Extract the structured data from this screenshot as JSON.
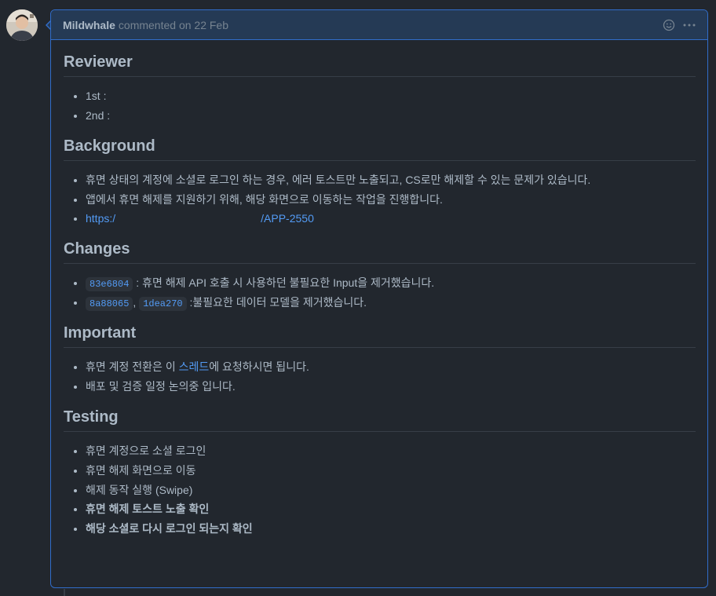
{
  "comment": {
    "author": "Mildwhale",
    "meta": "commented on 22 Feb"
  },
  "sections": {
    "reviewer": {
      "heading": "Reviewer",
      "items": [
        "1st :",
        "2nd :"
      ]
    },
    "background": {
      "heading": "Background",
      "items": [
        "휴면 상태의 계정에 소셜로 로그인 하는 경우, 에러 토스트만 노출되고, CS로만 해제할 수 있는 문제가 있습니다.",
        "앱에서 휴면 해제를 지원하기 위해, 해당 화면으로 이동하는 작업을 진행합니다."
      ],
      "link_prefix": "https:/",
      "link_suffix": "/APP-2550"
    },
    "changes": {
      "heading": "Changes",
      "items": [
        {
          "shas": [
            "83e6804"
          ],
          "text": " : 휴면 해제 API 호출 시 사용하던 불필요한 Input을 제거했습니다."
        },
        {
          "shas": [
            "8a88065",
            "1dea270"
          ],
          "separator": ", ",
          "text": " :불필요한 데이터 모델을 제거했습니다."
        }
      ]
    },
    "important": {
      "heading": "Important",
      "item1_before": "휴면 계정 전환은 이 ",
      "item1_link": "스레드",
      "item1_after": "에 요청하시면 됩니다.",
      "item2": "배포 및 검증 일정 논의중 입니다."
    },
    "testing": {
      "heading": "Testing",
      "items": [
        "휴면 계정으로 소셜 로그인",
        "휴면 해제 화면으로 이동",
        "해제 동작 실행 (Swipe)",
        "휴면 해제 토스트 노출 확인",
        "해당 소셜로 다시 로그인 되는지 확인"
      ]
    }
  },
  "icons": {
    "reaction": "smiley-icon",
    "more": "kebab-horizontal-icon"
  },
  "colors": {
    "background": "#22272e",
    "header": "#253a55",
    "border": "#316dca",
    "link": "#539bf5",
    "text": "#adbac7",
    "muted": "#768390"
  }
}
